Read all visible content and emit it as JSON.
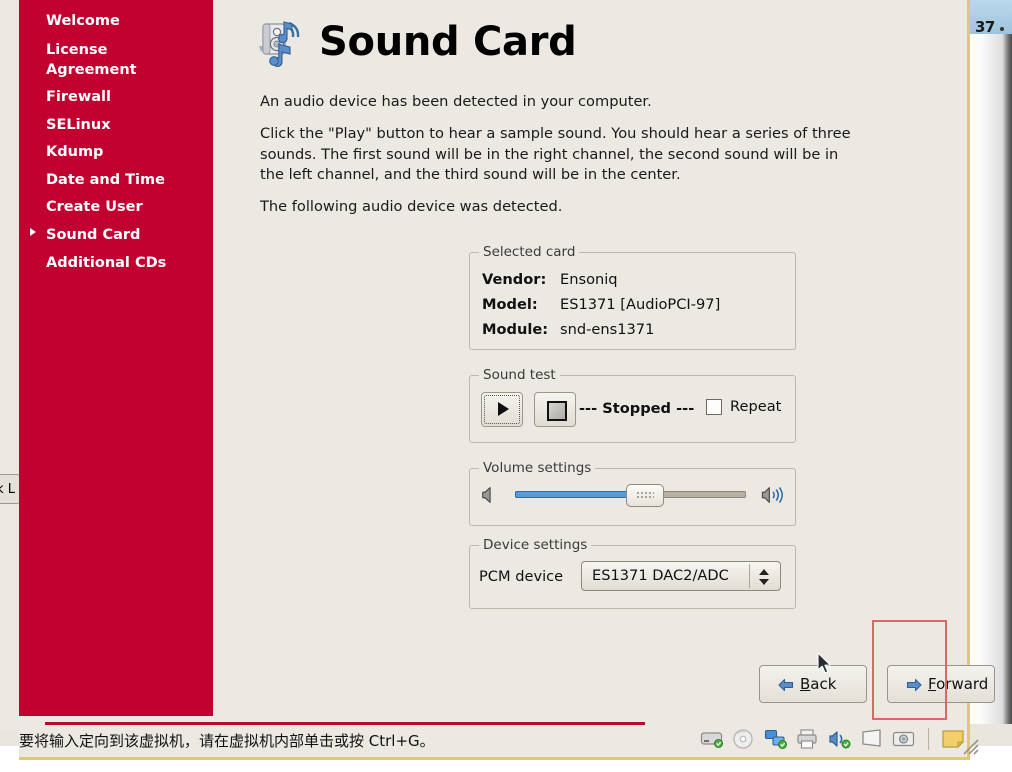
{
  "window": {
    "background_window_label": "37"
  },
  "background_ui": {
    "left_button_partial": "k L",
    "bottom_forward_partial": "Forward"
  },
  "sidebar": {
    "accent_color": "#c10230",
    "items": [
      {
        "label": "Welcome",
        "selected": false
      },
      {
        "label": "License Agreement",
        "line1": "License",
        "line2": "Agreement",
        "selected": false
      },
      {
        "label": "Firewall",
        "selected": false
      },
      {
        "label": "SELinux",
        "selected": false
      },
      {
        "label": "Kdump",
        "selected": false
      },
      {
        "label": "Date and Time",
        "selected": false
      },
      {
        "label": "Create User",
        "selected": false
      },
      {
        "label": "Sound Card",
        "selected": true
      },
      {
        "label": "Additional CDs",
        "selected": false
      }
    ]
  },
  "main": {
    "title": "Sound Card",
    "title_icon": "sound-card-icon",
    "paragraphs": {
      "p1": "An audio device has been detected in your computer.",
      "p2": "Click the \"Play\" button to hear a sample sound.  You should hear a series of three sounds.  The first sound will be in the right channel, the second sound will be in the left channel, and the third sound will be in the center.",
      "p3": "The following audio device was detected."
    },
    "selected_card": {
      "legend": "Selected card",
      "rows": [
        {
          "key": "Vendor:",
          "value": "Ensoniq"
        },
        {
          "key": "Model:",
          "value": "ES1371 [AudioPCI-97]"
        },
        {
          "key": "Module:",
          "value": "snd-ens1371"
        }
      ]
    },
    "sound_test": {
      "legend": "Sound test",
      "play_button": "play-button",
      "stop_button": "stop-button",
      "status": "--- Stopped ---",
      "repeat_label": "Repeat",
      "repeat_checked": false
    },
    "volume": {
      "legend": "Volume settings",
      "value_percent": 56,
      "low_icon": "speaker-low-icon",
      "high_icon": "speaker-high-icon",
      "fill_color": "#5b9bd5"
    },
    "device": {
      "legend": "Device settings",
      "label": "PCM device",
      "selected_option": "ES1371 DAC2/ADC"
    }
  },
  "nav": {
    "back": {
      "label_pre": "",
      "mnemonic": "B",
      "label_post": "ack",
      "icon": "arrow-left-icon"
    },
    "forward": {
      "label_pre": "",
      "mnemonic": "F",
      "label_post": "orward",
      "icon": "arrow-right-icon"
    }
  },
  "statusbar": {
    "message": "要将输入定向到该虚拟机，请在虚拟机内部单击或按 Ctrl+G。",
    "icons": [
      "harddisk-icon",
      "cdrom-icon",
      "network-icon",
      "printer-icon",
      "sound-icon",
      "display-icon",
      "camera-icon",
      "note-icon"
    ]
  },
  "annotation": {
    "highlight_color": "#e06666",
    "target": "forward-button"
  }
}
